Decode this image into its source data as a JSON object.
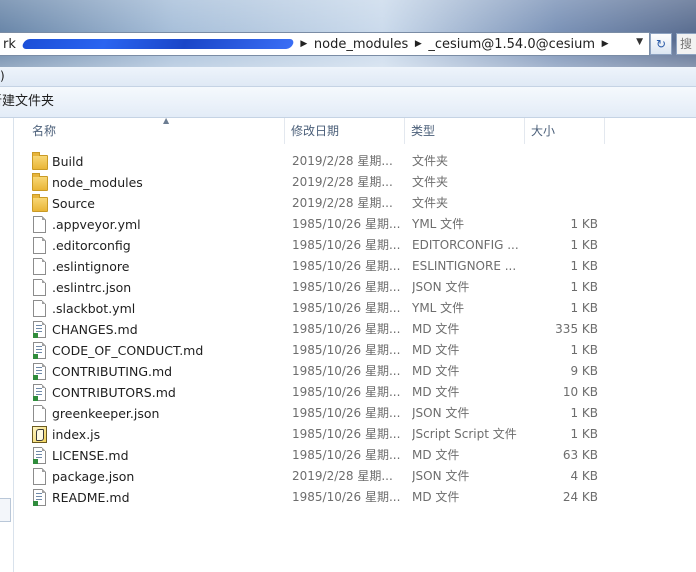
{
  "address_bar": {
    "crumbs": [
      "rk",
      "node_modules",
      "_cesium@1.54.0@cesium"
    ],
    "search_placeholder": "搜"
  },
  "menubar": {
    "partial_text": ")"
  },
  "toolbar": {
    "new_folder_label": "新建文件夹"
  },
  "columns": {
    "name": "名称",
    "date": "修改日期",
    "type": "类型",
    "size": "大小"
  },
  "files": [
    {
      "name": "Build",
      "date": "2019/2/28 星期...",
      "type": "文件夹",
      "size": "",
      "icon": "folder-icon"
    },
    {
      "name": "node_modules",
      "date": "2019/2/28 星期...",
      "type": "文件夹",
      "size": "",
      "icon": "folder-icon"
    },
    {
      "name": "Source",
      "date": "2019/2/28 星期...",
      "type": "文件夹",
      "size": "",
      "icon": "folder-icon"
    },
    {
      "name": ".appveyor.yml",
      "date": "1985/10/26 星期...",
      "type": "YML 文件",
      "size": "1 KB",
      "icon": "file-icon"
    },
    {
      "name": ".editorconfig",
      "date": "1985/10/26 星期...",
      "type": "EDITORCONFIG ...",
      "size": "1 KB",
      "icon": "file-icon"
    },
    {
      "name": ".eslintignore",
      "date": "1985/10/26 星期...",
      "type": "ESLINTIGNORE ...",
      "size": "1 KB",
      "icon": "file-icon"
    },
    {
      "name": ".eslintrc.json",
      "date": "1985/10/26 星期...",
      "type": "JSON 文件",
      "size": "1 KB",
      "icon": "file-icon"
    },
    {
      "name": ".slackbot.yml",
      "date": "1985/10/26 星期...",
      "type": "YML 文件",
      "size": "1 KB",
      "icon": "file-icon"
    },
    {
      "name": "CHANGES.md",
      "date": "1985/10/26 星期...",
      "type": "MD 文件",
      "size": "335 KB",
      "icon": "markdown-file-icon"
    },
    {
      "name": "CODE_OF_CONDUCT.md",
      "date": "1985/10/26 星期...",
      "type": "MD 文件",
      "size": "1 KB",
      "icon": "markdown-file-icon"
    },
    {
      "name": "CONTRIBUTING.md",
      "date": "1985/10/26 星期...",
      "type": "MD 文件",
      "size": "9 KB",
      "icon": "markdown-file-icon"
    },
    {
      "name": "CONTRIBUTORS.md",
      "date": "1985/10/26 星期...",
      "type": "MD 文件",
      "size": "10 KB",
      "icon": "markdown-file-icon"
    },
    {
      "name": "greenkeeper.json",
      "date": "1985/10/26 星期...",
      "type": "JSON 文件",
      "size": "1 KB",
      "icon": "file-icon"
    },
    {
      "name": "index.js",
      "date": "1985/10/26 星期...",
      "type": "JScript Script 文件",
      "size": "1 KB",
      "icon": "jscript-file-icon"
    },
    {
      "name": "LICENSE.md",
      "date": "1985/10/26 星期...",
      "type": "MD 文件",
      "size": "63 KB",
      "icon": "markdown-file-icon"
    },
    {
      "name": "package.json",
      "date": "2019/2/28 星期...",
      "type": "JSON 文件",
      "size": "4 KB",
      "icon": "file-icon"
    },
    {
      "name": "README.md",
      "date": "1985/10/26 星期...",
      "type": "MD 文件",
      "size": "24 KB",
      "icon": "markdown-file-icon"
    }
  ]
}
